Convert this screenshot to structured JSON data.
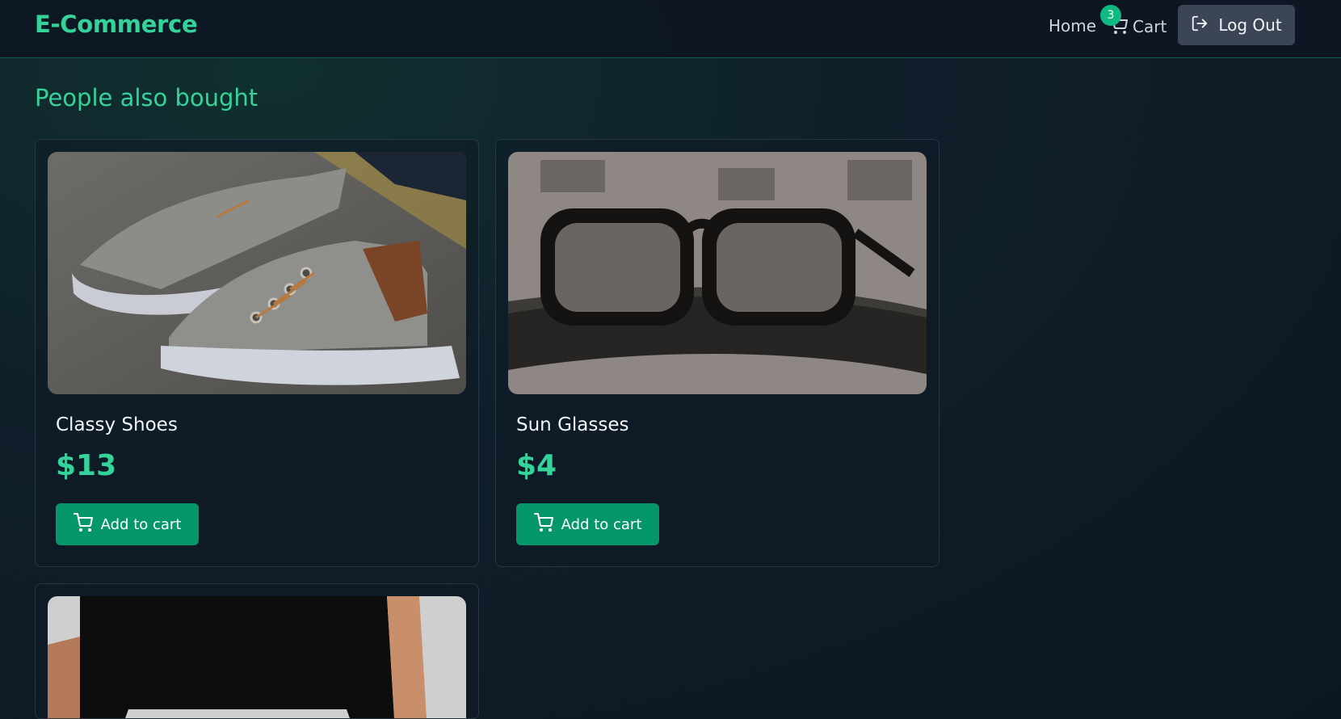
{
  "brand": "E-Commerce",
  "nav": {
    "home_label": "Home",
    "cart_label": "Cart",
    "cart_count": "3",
    "logout_label": "Log Out"
  },
  "section_title": "People also bought",
  "products": [
    {
      "name": "Classy Shoes",
      "price": "$13",
      "button_label": "Add to cart"
    },
    {
      "name": "Sun Glasses",
      "price": "$4",
      "button_label": "Add to cart"
    },
    {
      "name": "",
      "price": "",
      "button_label": ""
    }
  ],
  "colors": {
    "accent": "#34d399",
    "button": "#059669",
    "logout_bg": "#3b4556"
  },
  "icons": {
    "cart": "cart-icon",
    "logout": "logout-icon"
  }
}
